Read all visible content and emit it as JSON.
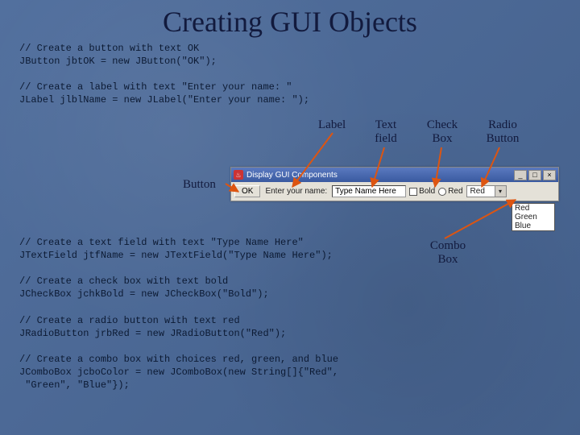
{
  "title": "Creating GUI Objects",
  "code": {
    "c1a": "// Create a button with text OK",
    "c1b": "JButton jbtOK = new JButton(\"OK\");",
    "c2a": "// Create a label with text \"Enter your name: \"",
    "c2b": "JLabel jlblName = new JLabel(\"Enter your name: \");",
    "c3a": "// Create a text field with text \"Type Name Here\"",
    "c3b": "JTextField jtfName = new JTextField(\"Type Name Here\");",
    "c4a": "// Create a check box with text bold",
    "c4b": "JCheckBox jchkBold = new JCheckBox(\"Bold\");",
    "c5a": "// Create a radio button with text red",
    "c5b": "JRadioButton jrbRed = new JRadioButton(\"Red\");",
    "c6a": "// Create a combo box with choices red, green, and blue",
    "c6b": "JComboBox jcboColor = new JComboBox(new String[]{\"Red\",",
    "c6c": " \"Green\", \"Blue\"});"
  },
  "annotations": {
    "label": "Label",
    "text1": "Text",
    "text2": "field",
    "check1": "Check",
    "check2": "Box",
    "radio1": "Radio",
    "radio2": "Button",
    "button": "Button",
    "combo1": "Combo",
    "combo2": "Box"
  },
  "window": {
    "title": "Display GUI Components",
    "button": "OK",
    "label": "Enter your name:",
    "textfield": "Type Name Here",
    "checkbox": "Bold",
    "radio": "Red",
    "combo_selected": "Red",
    "combo_options": {
      "o0": "Red",
      "o1": "Green",
      "o2": "Blue"
    },
    "min": "_",
    "max": "□",
    "close": "×",
    "arrow": "▾"
  }
}
